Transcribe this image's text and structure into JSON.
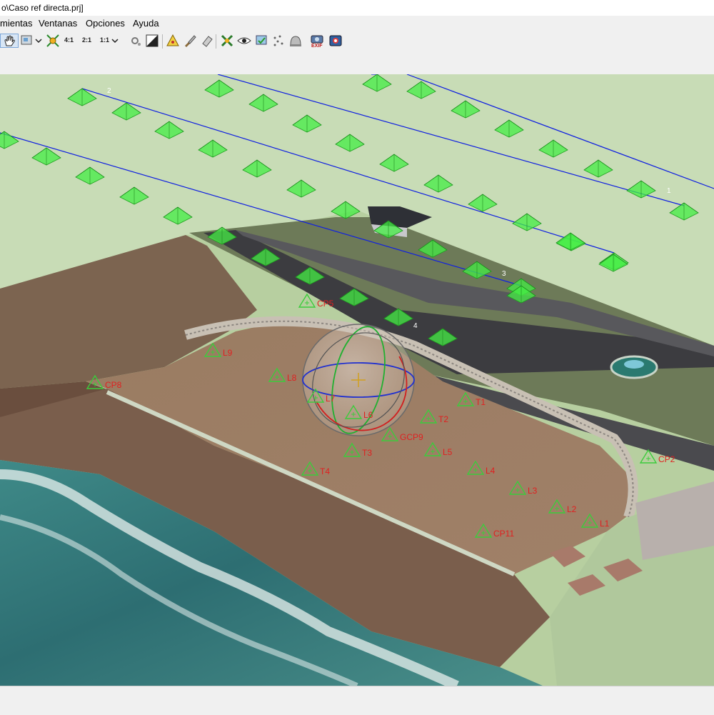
{
  "window": {
    "title": "o\\Caso ref directa.prj]"
  },
  "menu": {
    "items": [
      "mientas",
      "Ventanas",
      "Opciones",
      "Ayuda"
    ]
  },
  "toolbar": {
    "zoom_4_1": "4:1",
    "zoom_2_1": "2:1",
    "zoom_1_1": "1:1",
    "exif_label": "EXIF"
  },
  "flight_lines": {
    "labels": [
      "2",
      "1",
      "3",
      "4"
    ]
  },
  "points": [
    {
      "label": "CP5",
      "kind": "check"
    },
    {
      "label": "L9",
      "kind": "gcp"
    },
    {
      "label": "CP8",
      "kind": "check"
    },
    {
      "label": "L8",
      "kind": "gcp"
    },
    {
      "label": "L7",
      "kind": "gcp"
    },
    {
      "label": "L6",
      "kind": "gcp"
    },
    {
      "label": "T1",
      "kind": "gcp"
    },
    {
      "label": "T2",
      "kind": "gcp"
    },
    {
      "label": "GCP9",
      "kind": "gcp"
    },
    {
      "label": "T3",
      "kind": "gcp"
    },
    {
      "label": "L5",
      "kind": "gcp"
    },
    {
      "label": "T4",
      "kind": "gcp"
    },
    {
      "label": "L4",
      "kind": "gcp"
    },
    {
      "label": "CP2",
      "kind": "check"
    },
    {
      "label": "L3",
      "kind": "gcp"
    },
    {
      "label": "L2",
      "kind": "gcp"
    },
    {
      "label": "L1",
      "kind": "gcp"
    },
    {
      "label": "CP11",
      "kind": "check"
    }
  ],
  "colors": {
    "camera": "#44ee44",
    "flight_line": "#1020e0",
    "point_label": "#e02020",
    "point_marker": "#3ccc3c",
    "background": "#c8dcb6"
  }
}
